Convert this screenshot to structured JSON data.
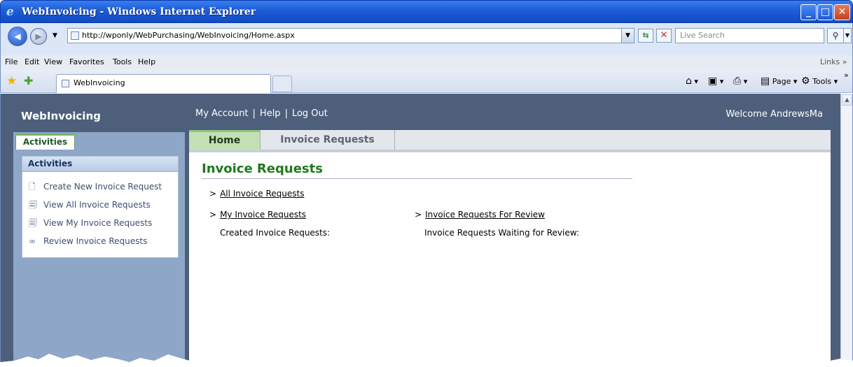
{
  "window": {
    "title": "WebInvoicing - Windows Internet Explorer",
    "min_glyph": "_",
    "max_glyph": "□",
    "close_glyph": "✕"
  },
  "address": {
    "url": "http://wponly/WebPurchasing/WebInvoicing/Home.aspx",
    "search_placeholder": "Live Search"
  },
  "menu": {
    "items": [
      "File",
      "Edit",
      "View",
      "Favorites",
      "Tools",
      "Help"
    ],
    "links": "Links"
  },
  "favorites": {
    "tab_title": "WebInvoicing",
    "commands": {
      "page": "Page",
      "tools": "Tools"
    }
  },
  "app": {
    "title": "WebInvoicing",
    "nav": {
      "account": "My Account",
      "help": "Help",
      "logout": "Log Out"
    },
    "welcome": "Welcome AndrewsMa"
  },
  "sidebar": {
    "tab": "Activities",
    "panel_header": "Activities",
    "items": [
      {
        "label": "Create New Invoice Request",
        "icon": "new-document-icon"
      },
      {
        "label": "View All Invoice Requests",
        "icon": "view-document-icon"
      },
      {
        "label": "View My Invoice Requests",
        "icon": "view-document-icon"
      },
      {
        "label": "Review Invoice Requests",
        "icon": "glasses-icon"
      }
    ]
  },
  "main": {
    "tabs": [
      "Home",
      "Invoice Requests"
    ],
    "section_title": "Invoice Requests",
    "links": {
      "all": "All Invoice Requests",
      "mine": "My Invoice Requests",
      "review": "Invoice Requests For Review"
    },
    "labels": {
      "created": "Created Invoice Requests:",
      "waiting": "Invoice Requests Waiting for Review:"
    },
    "link_marker": ">"
  },
  "colors": {
    "titlebar": "#1f5fd8",
    "app_header": "#4d5f7a",
    "sidebar": "#8ea6c7",
    "accent_green": "#1e7a1e"
  }
}
